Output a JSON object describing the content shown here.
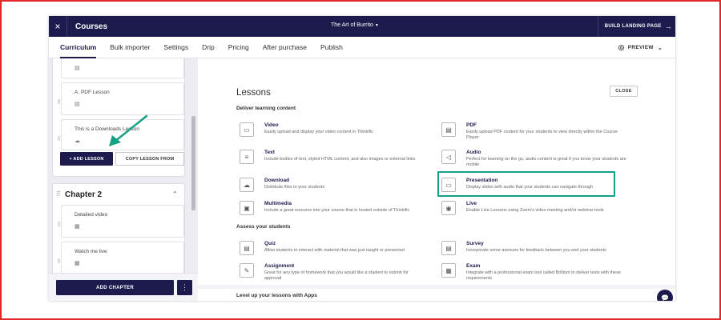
{
  "topbar": {
    "close_glyph": "×",
    "section_title": "Courses",
    "course_name": "The Art of Burrito",
    "course_caret": "▾",
    "build_label": "BUILD LANDING PAGE",
    "build_arrow": "→"
  },
  "tabs": [
    {
      "label": "Curriculum",
      "active": true
    },
    {
      "label": "Bulk importer"
    },
    {
      "label": "Settings"
    },
    {
      "label": "Drip"
    },
    {
      "label": "Pricing"
    },
    {
      "label": "After purchase"
    },
    {
      "label": "Publish"
    }
  ],
  "preview": {
    "label": "PREVIEW",
    "eye": "◎",
    "chevron": "⌄"
  },
  "left": {
    "lessons_top": [
      {
        "title": "",
        "icon": "▤"
      },
      {
        "title": "A. PDF Lesson",
        "icon": "▤"
      },
      {
        "title": "This is a Downloads Lesson",
        "icon": "☁"
      }
    ],
    "add_lesson_label": "+ ADD LESSON",
    "copy_lesson_label": "COPY LESSON FROM",
    "chapter": {
      "title": "Chapter 2",
      "grip": "⠿",
      "caret": "⌃"
    },
    "chapter_lessons": [
      {
        "title": "Detailed video",
        "icon": "▦"
      },
      {
        "title": "Watch me live",
        "icon": "▦"
      }
    ],
    "add_chapter_label": "ADD CHAPTER",
    "kebab": "⋮",
    "grip": "⠿"
  },
  "main": {
    "title": "Lessons",
    "close_label": "CLOSE",
    "deliver_heading": "Deliver learning content",
    "assess_heading": "Assess your students",
    "apps_heading": "Level up your lessons with Apps",
    "deliver_items": [
      {
        "name": "Video",
        "desc": "Easily upload and display your video content in Thinkific",
        "icon": "▭"
      },
      {
        "name": "PDF",
        "desc": "Easily upload PDF content for your students to view directly within the Course Player",
        "icon": "▤"
      },
      {
        "name": "Text",
        "desc": "Include bodies of text, styled HTML content, and also images or external links",
        "icon": "≡"
      },
      {
        "name": "Audio",
        "desc": "Perfect for learning on the go, audio content is great if you know your students are mobile",
        "icon": "◁"
      },
      {
        "name": "Download",
        "desc": "Distribute files to your students",
        "icon": "☁"
      },
      {
        "name": "Presentation",
        "desc": "Display slides with audio that your students can navigate through",
        "icon": "▭"
      },
      {
        "name": "Multimedia",
        "desc": "Include a great resource into your course that is hosted outside of Thinkific",
        "icon": "▣"
      },
      {
        "name": "Live",
        "desc": "Enable Live Lessons using Zoom's video meeting and/or webinar tools",
        "icon": "◉"
      }
    ],
    "assess_items": [
      {
        "name": "Quiz",
        "desc": "Allow students to interact with material that was just taught or presented",
        "icon": "▤"
      },
      {
        "name": "Survey",
        "desc": "Incorporate some avenues for feedback between you and your students",
        "icon": "▤"
      },
      {
        "name": "Assignment",
        "desc": "Great for any type of homework that you would like a student to submit for approval",
        "icon": "✎"
      },
      {
        "name": "Exam",
        "desc": "Integrate with a professional exam tool called Brillium to deliver tests with these requirements",
        "icon": "▦"
      }
    ],
    "chat_glyph": "💬"
  },
  "colors": {
    "navy": "#1d1b4d",
    "highlight_green": "#16a085",
    "frame_red": "#e3262a"
  }
}
